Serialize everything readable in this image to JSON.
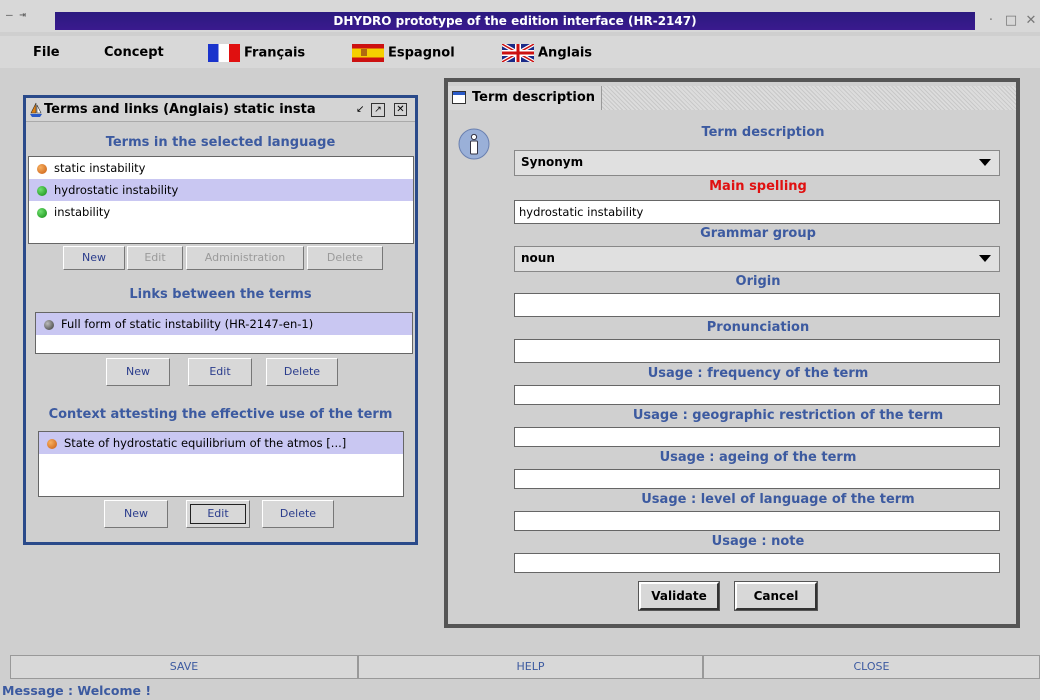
{
  "window": {
    "title": "DHYDRO prototype of the edition interface (HR-2147)",
    "left_controls": "— ⇥",
    "min_icon": "·",
    "max_icon": "□",
    "close_icon": "✕"
  },
  "menu": {
    "file": "File",
    "concept": "Concept",
    "francais": "Français",
    "espagnol": "Espagnol",
    "anglais": "Anglais"
  },
  "terms_window": {
    "title": "Terms and links (Anglais) static insta",
    "terms_section": "Terms in the selected language",
    "terms": [
      {
        "label": "static instability",
        "dot": "orange"
      },
      {
        "label": "hydrostatic instability",
        "dot": "green",
        "selected": true
      },
      {
        "label": "instability",
        "dot": "green"
      }
    ],
    "terms_buttons": {
      "new": "New",
      "edit": "Edit",
      "admin": "Administration",
      "delete": "Delete"
    },
    "links_section": "Links between the terms",
    "links": [
      {
        "label": "Full form of  static instability (HR-2147-en-1)",
        "dot": "gray",
        "selected": true
      }
    ],
    "links_buttons": {
      "new": "New",
      "edit": "Edit",
      "delete": "Delete"
    },
    "context_section": "Context attesting the effective use of the term",
    "contexts": [
      {
        "label": "State of hydrostatic equilibrium of the atmos [...]",
        "dot": "orange",
        "selected": true
      }
    ],
    "context_buttons": {
      "new": "New",
      "edit": "Edit",
      "delete": "Delete"
    }
  },
  "desc_window": {
    "title": "Term description",
    "heading": "Term description",
    "type_value": "Synonym",
    "main_spelling_label": "Main spelling",
    "main_spelling_value": "hydrostatic instability",
    "grammar_label": "Grammar group",
    "grammar_value": "noun",
    "origin_label": "Origin",
    "origin_value": "",
    "pronunciation_label": "Pronunciation",
    "pronunciation_value": "",
    "freq_label": "Usage : frequency of the term",
    "freq_value": "",
    "geo_label": "Usage : geographic restriction of the term",
    "geo_value": "",
    "ageing_label": "Usage : ageing of the term",
    "ageing_value": "",
    "level_label": "Usage : level of language of the term",
    "level_value": "",
    "note_label": "Usage : note",
    "note_value": "",
    "validate": "Validate",
    "cancel": "Cancel"
  },
  "bottom": {
    "save": "SAVE",
    "help": "HELP",
    "close": "CLOSE"
  },
  "status": "Message :  Welcome !"
}
